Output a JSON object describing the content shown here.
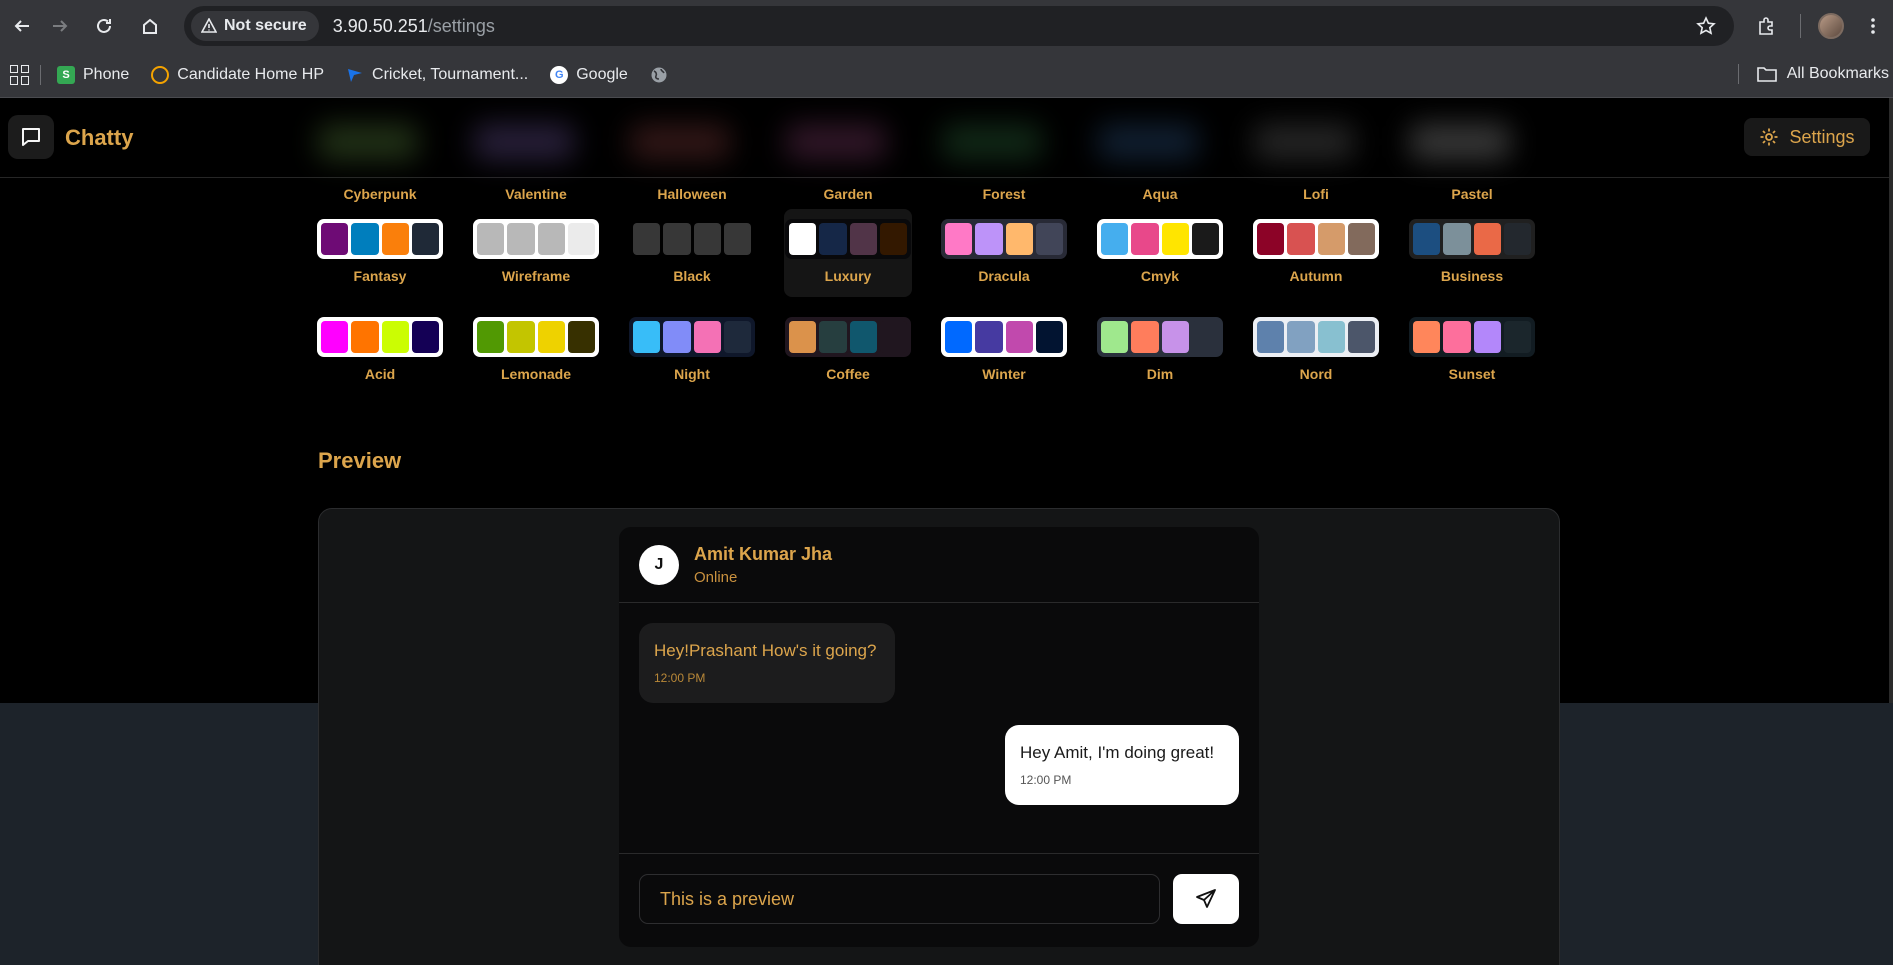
{
  "browser": {
    "security_label": "Not secure",
    "url_host": "3.90.50.251",
    "url_path": "/settings"
  },
  "bookmarks": [
    {
      "label": "Phone",
      "icon": "phone-bookmark-icon",
      "color": "#34a853"
    },
    {
      "label": "Candidate Home HP",
      "icon": "candidate-bookmark-icon",
      "color": "#f4a300"
    },
    {
      "label": "Cricket, Tournament...",
      "icon": "cricket-bookmark-icon",
      "color": "#1a73e8"
    },
    {
      "label": "Google",
      "icon": "google-icon",
      "color": "#ea4335"
    }
  ],
  "all_bookmarks": "All Bookmarks",
  "app": {
    "name": "Chatty",
    "settings_label": "Settings",
    "accent": "#dca54c"
  },
  "themes_top_row": [
    "Cyberpunk",
    "Valentine",
    "Halloween",
    "Garden",
    "Forest",
    "Aqua",
    "Lofi",
    "Pastel"
  ],
  "themes": [
    {
      "name": "Fantasy",
      "bg": "#ffffff",
      "colors": [
        "#6e0b75",
        "#007ebd",
        "#fa7f0b",
        "#1f2937"
      ]
    },
    {
      "name": "Wireframe",
      "bg": "#ffffff",
      "colors": [
        "#b8b8b8",
        "#b8b8b8",
        "#b8b8b8",
        "#ebebeb"
      ]
    },
    {
      "name": "Black",
      "bg": "#000000",
      "colors": [
        "#373737",
        "#373737",
        "#373737",
        "#373737"
      ]
    },
    {
      "name": "Luxury",
      "bg": "#09090b",
      "colors": [
        "#ffffff",
        "#152747",
        "#513448",
        "#331800"
      ]
    },
    {
      "name": "Dracula",
      "bg": "#282a36",
      "colors": [
        "#ff79c6",
        "#bd93f9",
        "#ffb86c",
        "#414558"
      ]
    },
    {
      "name": "Cmyk",
      "bg": "#ffffff",
      "colors": [
        "#45aeee",
        "#e8488a",
        "#ffe500",
        "#1a1a1a"
      ]
    },
    {
      "name": "Autumn",
      "bg": "#ffffff",
      "colors": [
        "#8c0327",
        "#d85251",
        "#d59b6a",
        "#826a5c"
      ]
    },
    {
      "name": "Business",
      "bg": "#202020",
      "colors": [
        "#1c4e80",
        "#7c909a",
        "#ea6947",
        "#23282e"
      ]
    },
    {
      "name": "Acid",
      "bg": "#ffffff",
      "colors": [
        "#ff00ff",
        "#ff7400",
        "#cbfd03",
        "#140055"
      ]
    },
    {
      "name": "Lemonade",
      "bg": "#ffffff",
      "colors": [
        "#519903",
        "#c3c500",
        "#eed200",
        "#373000"
      ]
    },
    {
      "name": "Night",
      "bg": "#0f172a",
      "colors": [
        "#38bdf8",
        "#818cf8",
        "#f471b5",
        "#1e293b"
      ]
    },
    {
      "name": "Coffee",
      "bg": "#20161f",
      "colors": [
        "#db924b",
        "#263e3f",
        "#10576d",
        "#20161f"
      ]
    },
    {
      "name": "Winter",
      "bg": "#ffffff",
      "colors": [
        "#0069ff",
        "#463aa1",
        "#c149ad",
        "#021431"
      ]
    },
    {
      "name": "Dim",
      "bg": "#2a303c",
      "colors": [
        "#9fe88d",
        "#ff7d5c",
        "#c792e9",
        "#2a303c"
      ]
    },
    {
      "name": "Nord",
      "bg": "#eceff4",
      "colors": [
        "#5e81ac",
        "#81a1c1",
        "#88c0d0",
        "#4c566a"
      ]
    },
    {
      "name": "Sunset",
      "bg": "#121c22",
      "colors": [
        "#ff865b",
        "#fd6f9c",
        "#b387fa",
        "#1b262c"
      ]
    }
  ],
  "preview": {
    "title": "Preview",
    "contact_initial": "J",
    "contact_name": "Amit Kumar Jha",
    "contact_status": "Online",
    "messages": [
      {
        "text": "Hey!Prashant How's it going?",
        "time": "12:00 PM",
        "sent": false
      },
      {
        "text": "Hey Amit, I'm doing great!",
        "time": "12:00 PM",
        "sent": true
      }
    ],
    "input_value": "This is a preview"
  }
}
